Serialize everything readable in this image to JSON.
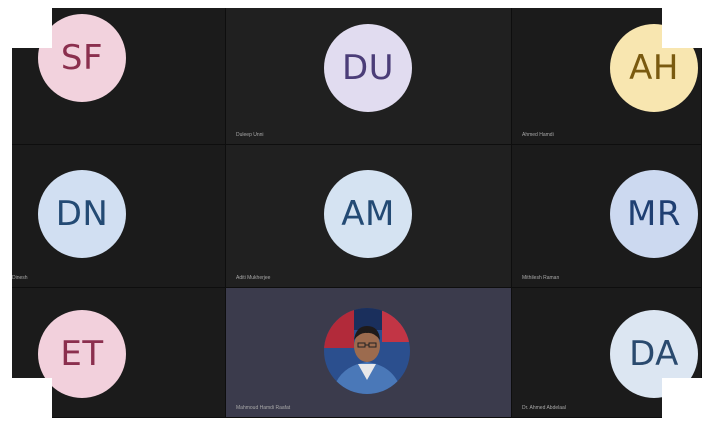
{
  "tiles": [
    {
      "initials": "SF",
      "name": "",
      "bg": "#f2d2dd",
      "fg": "#8b2f4e"
    },
    {
      "initials": "DU",
      "name": "Duleep Unni",
      "bg": "#e1dcf0",
      "fg": "#4b3d78"
    },
    {
      "initials": "AH",
      "name": "Ahmed Hamdi",
      "bg": "#f8e6b0",
      "fg": "#7a5a10"
    },
    {
      "initials": "DN",
      "name": "Dinesh",
      "bg": "#d1dff2",
      "fg": "#234a74"
    },
    {
      "initials": "AM",
      "name": "Aditi Mukherjee",
      "bg": "#d5e3f2",
      "fg": "#234a74"
    },
    {
      "initials": "MR",
      "name": "Mithilesh Raman",
      "bg": "#ccd9f0",
      "fg": "#1f3f72"
    },
    {
      "initials": "ET",
      "name": "",
      "bg": "#f2d0dc",
      "fg": "#8b2f4e"
    },
    {
      "initials": "",
      "name": "Mahmoud Hamdi Raafat",
      "bg": "",
      "fg": ""
    },
    {
      "initials": "DA",
      "name": "Dr. Ahmed Abdelaal",
      "bg": "#dce6f2",
      "fg": "#2a4a6e"
    }
  ],
  "colors": {
    "stage": "#161616",
    "featured_tile": "#3b3b4c",
    "name_text": "#a8a8a8"
  }
}
